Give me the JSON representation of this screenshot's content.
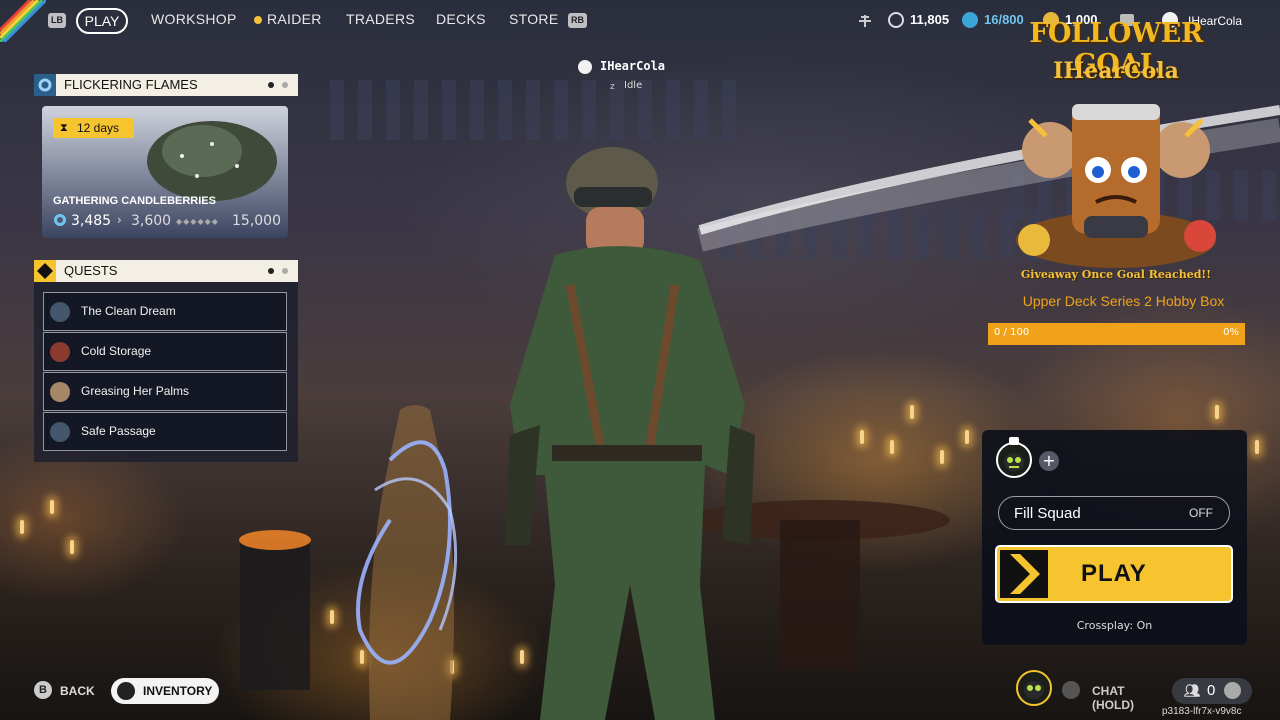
{
  "nav": {
    "left_bumper": "LB",
    "right_bumper": "RB",
    "tabs": [
      {
        "label": "PLAY"
      },
      {
        "label": "WORKSHOP"
      },
      {
        "label": "RAIDER"
      },
      {
        "label": "TRADERS"
      },
      {
        "label": "DECKS"
      },
      {
        "label": "STORE"
      }
    ],
    "coins": "11,805",
    "tokens": "16/800",
    "credits": "1,000",
    "username": "IHearCola"
  },
  "player": {
    "name": "IHearCola",
    "status": "Idle"
  },
  "event": {
    "title": "FLICKERING FLAMES",
    "timer": "12 days",
    "subtitle": "GATHERING CANDLEBERRIES",
    "current": "3,485",
    "next": "3,600",
    "goal": "15,000"
  },
  "quests": {
    "title": "QUESTS",
    "items": [
      {
        "name": "The Clean Dream"
      },
      {
        "name": "Cold Storage"
      },
      {
        "name": "Greasing Her Palms"
      },
      {
        "name": "Safe Passage"
      }
    ]
  },
  "stream_overlay": {
    "heading": "FOLLOWER GOAL",
    "channel": "IHearCola",
    "note": "Giveaway Once Goal Reached!!",
    "prize": "Upper Deck Series 2 Hobby Box",
    "progress_text": "0 / 100",
    "progress_percent_text": "0%",
    "progress_fraction": 0
  },
  "squad": {
    "fill_squad_label": "Fill Squad",
    "fill_squad_value": "OFF",
    "play_label": "PLAY",
    "crossplay": "Crossplay: On"
  },
  "bottom": {
    "back_key": "B",
    "back_label": "BACK",
    "inventory_label": "INVENTORY",
    "chat_label": "CHAT (HOLD)",
    "party_count": "0",
    "session_code": "p3183-lfr7x-v9v8c"
  },
  "colors": {
    "accent_yellow": "#f6c42f",
    "progress_orange": "#f0a21b",
    "panel_cream": "#f3efe4",
    "event_icon_blue": "#2a5f8b"
  }
}
